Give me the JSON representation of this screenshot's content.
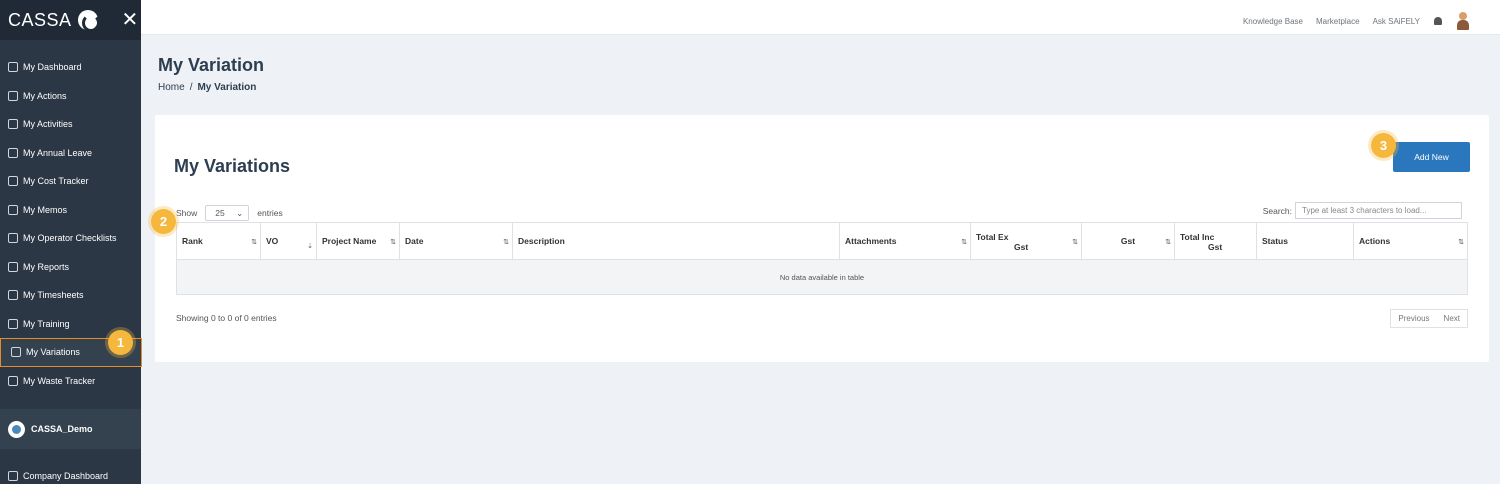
{
  "brand": {
    "name": "CASSA"
  },
  "sidebar": {
    "items": [
      {
        "label": "My Dashboard"
      },
      {
        "label": "My Actions"
      },
      {
        "label": "My Activities"
      },
      {
        "label": "My Annual Leave"
      },
      {
        "label": "My Cost Tracker"
      },
      {
        "label": "My Memos"
      },
      {
        "label": "My Operator Checklists"
      },
      {
        "label": "My Reports"
      },
      {
        "label": "My Timesheets"
      },
      {
        "label": "My Training"
      },
      {
        "label": "My Variations"
      },
      {
        "label": "My Waste Tracker"
      }
    ],
    "active_index": 10,
    "org_name": "CASSA_Demo",
    "company_item": "Company Dashboard"
  },
  "topnav": {
    "knowledge_base": "Knowledge Base",
    "marketplace": "Marketplace",
    "ask": "Ask SAiFELY"
  },
  "page": {
    "title": "My Variation",
    "breadcrumb": {
      "home": "Home",
      "sep": "/",
      "current": "My Variation"
    }
  },
  "card": {
    "title": "My Variations",
    "add_new": "Add New",
    "show_label": "Show",
    "entries_value": "25",
    "entries_label": "entries",
    "search_label": "Search:",
    "search_placeholder": "Type at least 3 characters to load..."
  },
  "table": {
    "columns": {
      "rank": "Rank",
      "vo": "VO",
      "project_name": "Project Name",
      "date": "Date",
      "description": "Description",
      "attachments": "Attachments",
      "total_ex_1": "Total Ex",
      "total_ex_2": "Gst",
      "gst": "Gst",
      "total_inc_1": "Total Inc",
      "total_inc_2": "Gst",
      "status": "Status",
      "actions": "Actions"
    },
    "empty": "No data available in table",
    "info": "Showing 0 to 0 of 0 entries",
    "previous": "Previous",
    "next": "Next"
  },
  "badges": {
    "one": "1",
    "two": "2",
    "three": "3"
  },
  "colors": {
    "sidebar": "#2b3744",
    "accent": "#2b77bd",
    "badge": "#f5b83d",
    "active_border": "#e58d26"
  }
}
